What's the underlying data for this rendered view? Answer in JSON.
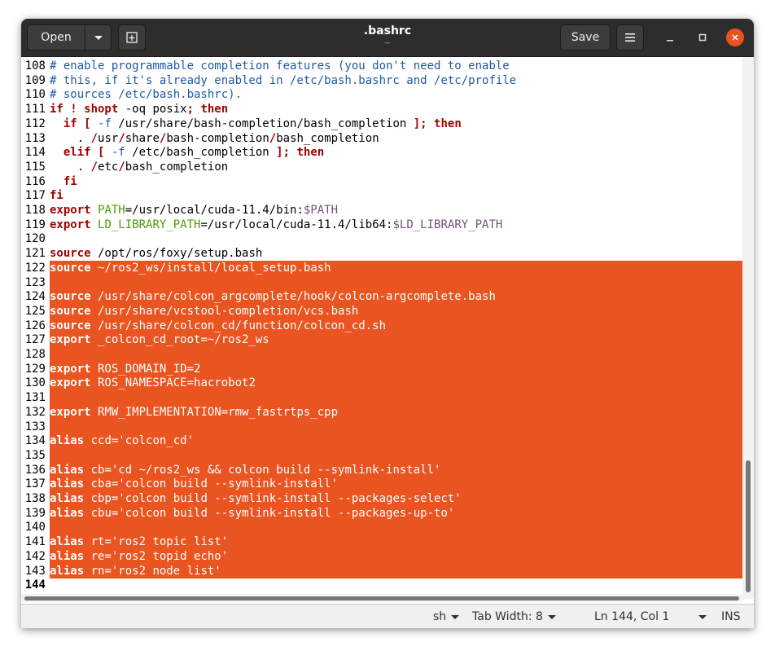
{
  "header": {
    "open_label": "Open",
    "save_label": "Save",
    "title": ".bashrc",
    "subtitle": "~"
  },
  "lines": [
    {
      "n": "108",
      "segs": [
        [
          "c",
          "# enable programmable completion features (you don't need to enable"
        ]
      ]
    },
    {
      "n": "109",
      "segs": [
        [
          "c",
          "# this, if it's already enabled in /etc/bash.bashrc and /etc/profile"
        ]
      ]
    },
    {
      "n": "110",
      "segs": [
        [
          "c",
          "# sources /etc/bash.bashrc)."
        ]
      ]
    },
    {
      "n": "111",
      "segs": [
        [
          "k",
          "if ! shopt"
        ],
        [
          "",
          " -oq posix"
        ],
        [
          "k",
          "; then"
        ]
      ]
    },
    {
      "n": "112",
      "segs": [
        [
          "",
          "  "
        ],
        [
          "k",
          "if ["
        ],
        [
          "",
          " "
        ],
        [
          "c",
          "-f"
        ],
        [
          "",
          " /usr/share/bash-completion/bash_completion "
        ],
        [
          "k",
          "]; then"
        ]
      ]
    },
    {
      "n": "113",
      "segs": [
        [
          "",
          "    . "
        ],
        [
          "k",
          "/"
        ],
        [
          "",
          "usr"
        ],
        [
          "k",
          "/"
        ],
        [
          "",
          "share"
        ],
        [
          "k",
          "/"
        ],
        [
          "",
          "bash-completion"
        ],
        [
          "k",
          "/"
        ],
        [
          "",
          "bash_completion"
        ]
      ]
    },
    {
      "n": "114",
      "segs": [
        [
          "",
          "  "
        ],
        [
          "k",
          "elif ["
        ],
        [
          "",
          " "
        ],
        [
          "c",
          "-f"
        ],
        [
          "",
          " /etc/bash_completion "
        ],
        [
          "k",
          "]; then"
        ]
      ]
    },
    {
      "n": "115",
      "segs": [
        [
          "",
          "    . "
        ],
        [
          "k",
          "/"
        ],
        [
          "",
          "etc"
        ],
        [
          "k",
          "/"
        ],
        [
          "",
          "bash_completion"
        ]
      ]
    },
    {
      "n": "116",
      "segs": [
        [
          "",
          "  "
        ],
        [
          "k",
          "fi"
        ]
      ]
    },
    {
      "n": "117",
      "segs": [
        [
          "k",
          "fi"
        ]
      ]
    },
    {
      "n": "118",
      "segs": [
        [
          "k",
          "export"
        ],
        [
          "",
          " "
        ],
        [
          "g",
          "PATH"
        ],
        [
          "",
          "=/usr/local/cuda-11.4/bin:"
        ],
        [
          "v",
          "$PATH"
        ]
      ]
    },
    {
      "n": "119",
      "segs": [
        [
          "k",
          "export"
        ],
        [
          "",
          " "
        ],
        [
          "g",
          "LD_LIBRARY_PATH"
        ],
        [
          "",
          "=/usr/local/cuda-11.4/lib64:"
        ],
        [
          "v",
          "$LD_LIBRARY_PATH"
        ]
      ]
    },
    {
      "n": "120",
      "segs": []
    },
    {
      "n": "121",
      "segs": [
        [
          "k",
          "source"
        ],
        [
          "",
          " /opt/ros/foxy/setup.bash"
        ]
      ]
    },
    {
      "n": "122",
      "sel": true,
      "segs": [
        [
          "k",
          "source"
        ],
        [
          "",
          " ~/ros2_ws/install/local_setup.bash"
        ]
      ]
    },
    {
      "n": "123",
      "sel": true,
      "segs": []
    },
    {
      "n": "124",
      "sel": true,
      "segs": [
        [
          "k",
          "source"
        ],
        [
          "",
          " /usr/share/colcon_argcomplete/hook/colcon-argcomplete.bash"
        ]
      ]
    },
    {
      "n": "125",
      "sel": true,
      "segs": [
        [
          "k",
          "source"
        ],
        [
          "",
          " /usr/share/vcstool-completion/vcs.bash"
        ]
      ]
    },
    {
      "n": "126",
      "sel": true,
      "segs": [
        [
          "k",
          "source"
        ],
        [
          "",
          " /usr/share/colcon_cd/function/colcon_cd.sh"
        ]
      ]
    },
    {
      "n": "127",
      "sel": true,
      "segs": [
        [
          "k",
          "export"
        ],
        [
          "",
          " _colcon_cd_root=~/ros2_ws"
        ]
      ]
    },
    {
      "n": "128",
      "sel": true,
      "segs": []
    },
    {
      "n": "129",
      "sel": true,
      "segs": [
        [
          "k",
          "export"
        ],
        [
          "",
          " ROS_DOMAIN_ID=2"
        ]
      ]
    },
    {
      "n": "130",
      "sel": true,
      "segs": [
        [
          "k",
          "export"
        ],
        [
          "",
          " ROS_NAMESPACE=hacrobot2"
        ]
      ]
    },
    {
      "n": "131",
      "sel": true,
      "segs": []
    },
    {
      "n": "132",
      "sel": true,
      "segs": [
        [
          "k",
          "export"
        ],
        [
          "",
          " RMW_IMPLEMENTATION=rmw_fastrtps_cpp"
        ]
      ]
    },
    {
      "n": "133",
      "sel": true,
      "segs": []
    },
    {
      "n": "134",
      "sel": true,
      "segs": [
        [
          "k",
          "alias"
        ],
        [
          "",
          " ccd='colcon_cd'"
        ]
      ]
    },
    {
      "n": "135",
      "sel": true,
      "segs": []
    },
    {
      "n": "136",
      "sel": true,
      "segs": [
        [
          "k",
          "alias"
        ],
        [
          "",
          " cb='cd ~/ros2_ws && colcon build --symlink-install'"
        ]
      ]
    },
    {
      "n": "137",
      "sel": true,
      "segs": [
        [
          "k",
          "alias"
        ],
        [
          "",
          " cba='colcon build --symlink-install'"
        ]
      ]
    },
    {
      "n": "138",
      "sel": true,
      "segs": [
        [
          "k",
          "alias"
        ],
        [
          "",
          " cbp='colcon build --symlink-install --packages-select'"
        ]
      ]
    },
    {
      "n": "139",
      "sel": true,
      "segs": [
        [
          "k",
          "alias"
        ],
        [
          "",
          " cbu='colcon build --symlink-install --packages-up-to'"
        ]
      ]
    },
    {
      "n": "140",
      "sel": true,
      "segs": []
    },
    {
      "n": "141",
      "sel": true,
      "segs": [
        [
          "k",
          "alias"
        ],
        [
          "",
          " rt='ros2 topic list'"
        ]
      ]
    },
    {
      "n": "142",
      "sel": true,
      "segs": [
        [
          "k",
          "alias"
        ],
        [
          "",
          " re='ros2 topid echo'"
        ]
      ]
    },
    {
      "n": "143",
      "sel": true,
      "segs": [
        [
          "k",
          "alias"
        ],
        [
          "",
          " rn='ros2 node list'"
        ]
      ]
    },
    {
      "n": "144",
      "cur": true,
      "segs": []
    }
  ],
  "status": {
    "language": "sh",
    "tab_width": "Tab Width: 8",
    "position": "Ln 144, Col 1",
    "mode": "INS"
  },
  "colors": {
    "selection": "#e95420",
    "comment": "#1c5aa8",
    "keyword": "#a40000",
    "variable": "#75507b",
    "env": "#4e9a06"
  }
}
